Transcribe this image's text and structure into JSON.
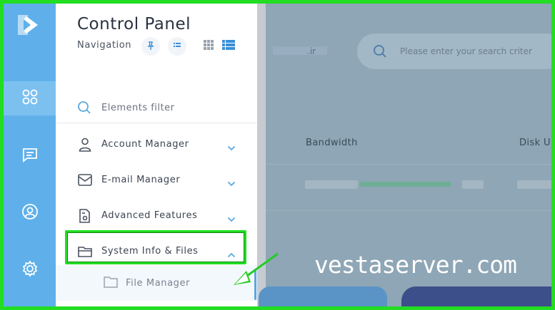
{
  "nav": {
    "title": "Control Panel",
    "subtitle": "Navigation",
    "filter_label": "Elements filter",
    "items": [
      {
        "label": "Account Manager",
        "icon": "user-icon"
      },
      {
        "label": "E-mail Manager",
        "icon": "envelope-icon"
      },
      {
        "label": "Advanced Features",
        "icon": "document-gear-icon"
      },
      {
        "label": "System Info & Files",
        "icon": "folder-icon",
        "expanded": true
      }
    ],
    "sub_item": {
      "label": "File Manager",
      "icon": "folder-icon"
    }
  },
  "main": {
    "domain_suffix": ".ir",
    "search_placeholder": "Please enter your search criter",
    "columns": {
      "bandwidth": "Bandwidth",
      "disk": "Disk U"
    }
  },
  "watermark": "vestaserver.com",
  "colors": {
    "rail": "#5fb0ea",
    "highlight": "#22dd22",
    "accent": "#5aa8e0"
  }
}
